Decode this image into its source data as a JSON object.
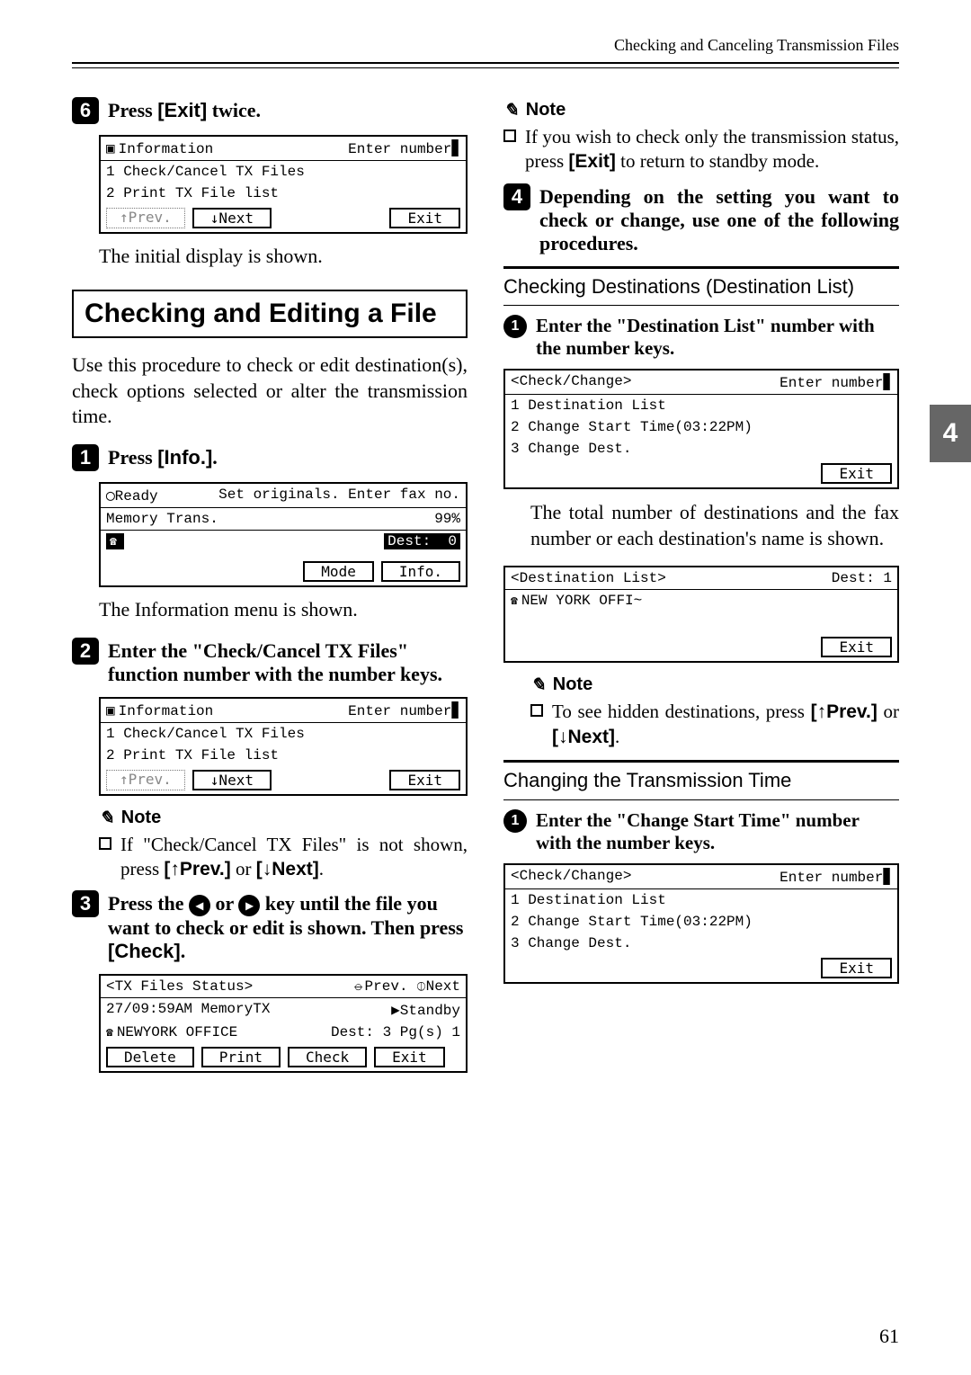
{
  "runhead": "Checking and Canceling Transmission Files",
  "left": {
    "step6": {
      "text_a": "Press ",
      "key": "[Exit]",
      "text_b": " twice."
    },
    "lcd1": {
      "title": "Information",
      "prompt": "Enter number",
      "l1": "1 Check/Cancel TX Files",
      "l2": "2 Print TX File list",
      "prev": "↑Prev.",
      "next": "↓Next",
      "exit": "Exit"
    },
    "cap1": "The initial display is shown.",
    "h2": "Checking and Editing a File",
    "intro": "Use this procedure to check or edit destination(s), check options selected or alter the transmission time.",
    "step1": {
      "text_a": "Press ",
      "key": "[Info.]",
      "text_b": "."
    },
    "lcd2": {
      "ready": "Ready",
      "prompt": "Set originals. Enter fax no.",
      "mem": "Memory Trans.",
      "pct": "99%",
      "dest": "Dest:",
      "destv": "0",
      "mode": "Mode",
      "info": "Info."
    },
    "cap2": "The Information menu is shown.",
    "step2": "Enter the \"Check/Cancel TX Files\" function number with the number keys.",
    "lcd3": {
      "title": "Information",
      "prompt": "Enter number",
      "l1": "1 Check/Cancel TX Files",
      "l2": "2 Print TX File list",
      "prev": "↑Prev.",
      "next": "↓Next",
      "exit": "Exit"
    },
    "note_label": "Note",
    "note1_a": "If \"Check/Cancel TX Files\" is not shown, press ",
    "note1_k1": "[↑Prev.]",
    "note1_mid": " or ",
    "note1_k2": "[↓Next]",
    "note1_end": ".",
    "step3_a": "Press the ",
    "step3_b": " or ",
    "step3_c": " key until the file you want to check or edit is shown. Then press ",
    "step3_key": "[Check]",
    "step3_d": ".",
    "lcd4": {
      "title": "<TX Files Status>",
      "nav": "⦵Prev. ⦶Next",
      "l1a": "27/09:59AM MemoryTX",
      "l1b": "▶Standby",
      "l2a": "NEWYORK OFFICE",
      "l2b": "Dest:  3 Pg(s)  1",
      "b1": "Delete",
      "b2": "Print",
      "b3": "Check",
      "b4": "Exit"
    }
  },
  "right": {
    "note_label": "Note",
    "note_top_a": "If you wish to check only the transmission status, press ",
    "note_top_key": "[Exit]",
    "note_top_b": " to return to standby mode.",
    "step4": "Depending on the setting you want to check or change, use one of the following procedures.",
    "sub1": "Checking Destinations (Destination List)",
    "c1": "Enter the \"Destination List\" number with the number keys.",
    "lcdA": {
      "title": "<Check/Change>",
      "prompt": "Enter number",
      "l1": "1 Destination List",
      "l2": "2 Change Start Time(03:22PM)",
      "l3": "3 Change Dest.",
      "exit": "Exit"
    },
    "capA": "The total number of destinations and the fax number or each destination's name is shown.",
    "lcdB": {
      "title": "<Destination List>",
      "dest": "Dest:  1",
      "l1": "NEW YORK OFFI~",
      "exit": "Exit"
    },
    "noteB_a": "To see hidden destinations, press ",
    "noteB_k1": "[↑Prev.]",
    "noteB_mid": " or ",
    "noteB_k2": "[↓Next]",
    "noteB_end": ".",
    "sub2": "Changing the Transmission Time",
    "c2": "Enter the \"Change Start Time\" number with the number keys.",
    "lcdC": {
      "title": "<Check/Change>",
      "prompt": "Enter number",
      "l1": "1 Destination List",
      "l2": "2 Change Start Time(03:22PM)",
      "l3": "3 Change Dest.",
      "exit": "Exit"
    }
  },
  "side_tab": "4",
  "page_number": "61"
}
